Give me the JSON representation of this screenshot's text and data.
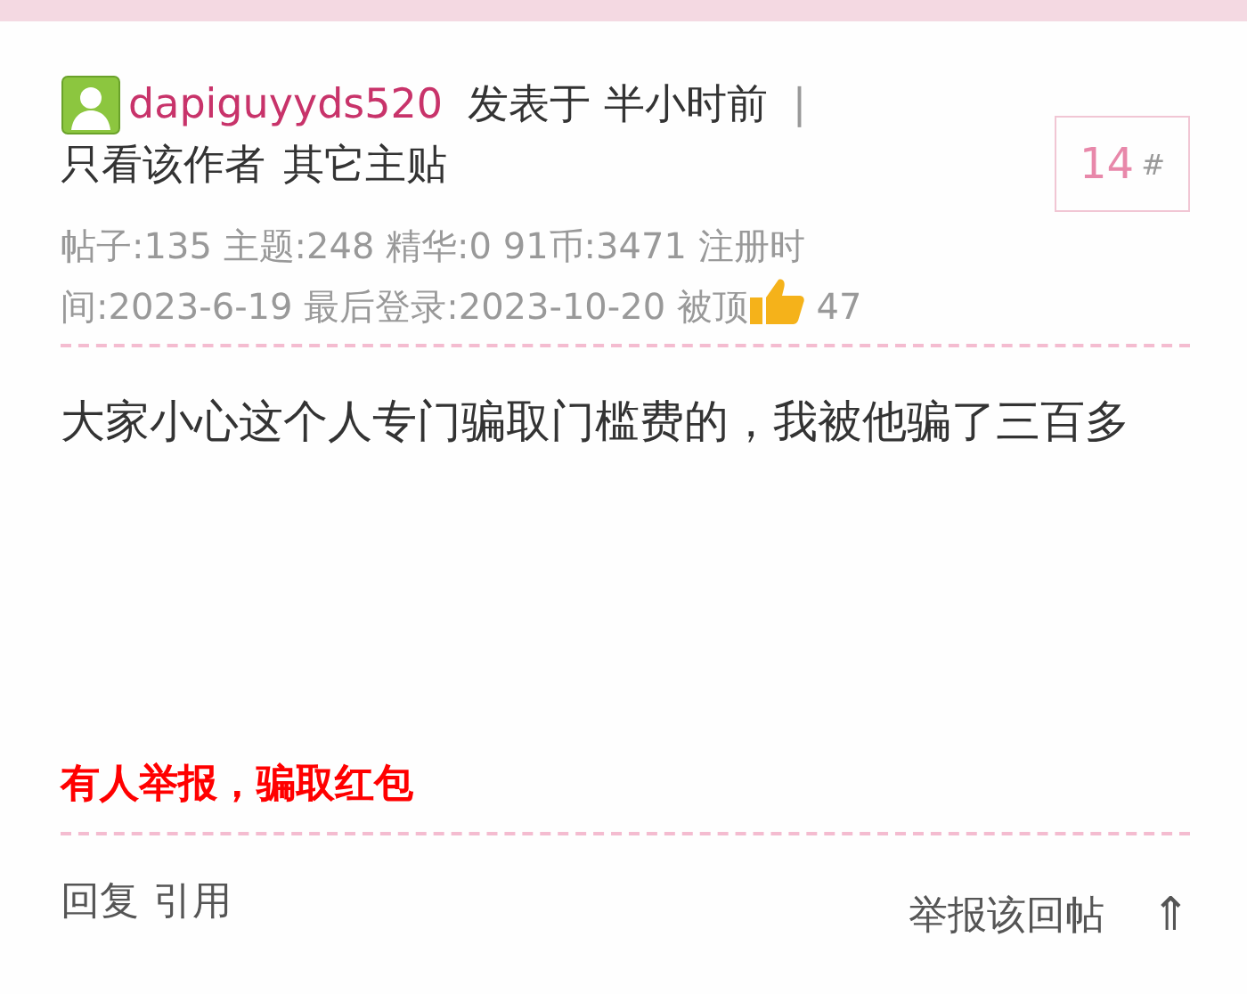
{
  "post": {
    "author": "dapiguyyds520",
    "posted": "发表于 半小时前",
    "separator": "|",
    "author_only": "只看该作者",
    "other_posts": "其它主贴",
    "floor": "14",
    "floor_mark": "#",
    "stats_lines": [
      "帖子:135 主题:248 精华:0 91币:3471  注册时",
      "间:2023-6-19 最后登录:2023-10-20 被顶"
    ],
    "likes": "47",
    "body": "大家小心这个人专门骗取门槛费的，我被他骗了三百多",
    "notice": "有人举报，骗取红包",
    "actions": [
      {
        "label": "回复"
      },
      {
        "label": "引用"
      }
    ],
    "report": "举报该回帖",
    "top": "⇑"
  }
}
